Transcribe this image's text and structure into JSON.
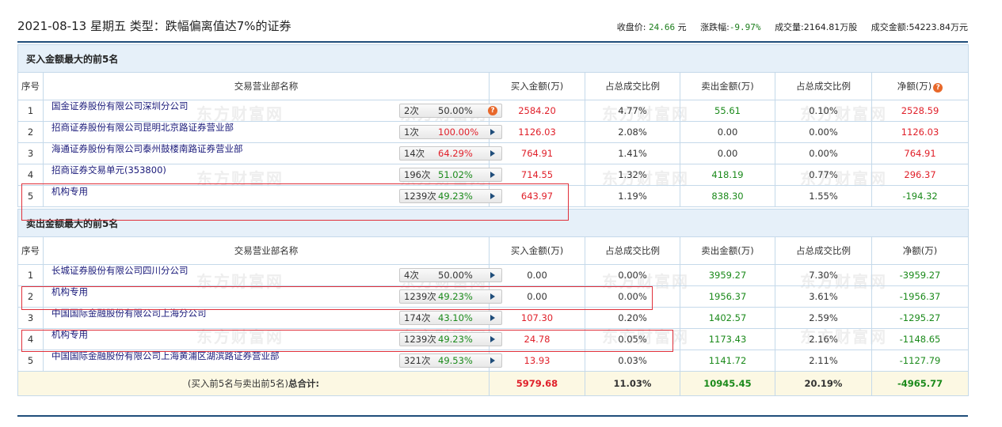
{
  "header": {
    "title": "2021-08-13 星期五 类型：跌幅偏离值达7%的证券",
    "close_label": "收盘价:",
    "close_value": "24.66",
    "close_unit": "元",
    "change_label": "涨跌幅:",
    "change_value": "-9.97%",
    "volume_label": "成交量:",
    "volume_value": "2164.81万股",
    "amount_label": "成交金额:",
    "amount_value": "54223.84万元"
  },
  "watermark": "东方财富网",
  "buy_section": {
    "title": "买入金额最大的前5名",
    "columns": [
      "序号",
      "交易营业部名称",
      "买入金额(万)",
      "占总成交比例",
      "卖出金额(万)",
      "占总成交比例",
      "净额(万)"
    ],
    "rows": [
      {
        "no": "1",
        "name": "国金证券股份有限公司深圳分公司",
        "count": "2次",
        "pct": "50.00%",
        "buy": "2584.20",
        "buy_ratio": "4.77%",
        "sell": "55.61",
        "sell_ratio": "0.10%",
        "net": "2528.59"
      },
      {
        "no": "2",
        "name": "招商证券股份有限公司昆明北京路证券营业部",
        "count": "1次",
        "pct": "100.00%",
        "buy": "1126.03",
        "buy_ratio": "2.08%",
        "sell": "0.00",
        "sell_ratio": "0.00%",
        "net": "1126.03"
      },
      {
        "no": "3",
        "name": "海通证券股份有限公司泰州鼓楼南路证券营业部",
        "count": "14次",
        "pct": "64.29%",
        "buy": "764.91",
        "buy_ratio": "1.41%",
        "sell": "0.00",
        "sell_ratio": "0.00%",
        "net": "764.91"
      },
      {
        "no": "4",
        "name": "招商证券交易单元(353800)",
        "count": "196次",
        "pct": "51.02%",
        "buy": "714.55",
        "buy_ratio": "1.32%",
        "sell": "418.19",
        "sell_ratio": "0.77%",
        "net": "296.37"
      },
      {
        "no": "5",
        "name": "机构专用",
        "count": "1239次",
        "pct": "49.23%",
        "buy": "643.97",
        "buy_ratio": "1.19%",
        "sell": "838.30",
        "sell_ratio": "1.55%",
        "net": "-194.32"
      }
    ]
  },
  "sell_section": {
    "title": "卖出金额最大的前5名",
    "columns": [
      "序号",
      "交易营业部名称",
      "买入金额(万)",
      "占总成交比例",
      "卖出金额(万)",
      "占总成交比例",
      "净额(万)"
    ],
    "rows": [
      {
        "no": "1",
        "name": "长城证券股份有限公司四川分公司",
        "count": "4次",
        "pct": "50.00%",
        "buy": "0.00",
        "buy_ratio": "0.00%",
        "sell": "3959.27",
        "sell_ratio": "7.30%",
        "net": "-3959.27"
      },
      {
        "no": "2",
        "name": "机构专用",
        "count": "1239次",
        "pct": "49.23%",
        "buy": "0.00",
        "buy_ratio": "0.00%",
        "sell": "1956.37",
        "sell_ratio": "3.61%",
        "net": "-1956.37"
      },
      {
        "no": "3",
        "name": "中国国际金融股份有限公司上海分公司",
        "count": "174次",
        "pct": "43.10%",
        "buy": "107.30",
        "buy_ratio": "0.20%",
        "sell": "1402.57",
        "sell_ratio": "2.59%",
        "net": "-1295.27"
      },
      {
        "no": "4",
        "name": "机构专用",
        "count": "1239次",
        "pct": "49.23%",
        "buy": "24.78",
        "buy_ratio": "0.05%",
        "sell": "1173.43",
        "sell_ratio": "2.16%",
        "net": "-1148.65"
      },
      {
        "no": "5",
        "name": "中国国际金融股份有限公司上海黄浦区湖滨路证券营业部",
        "count": "321次",
        "pct": "49.53%",
        "buy": "13.93",
        "buy_ratio": "0.03%",
        "sell": "1141.72",
        "sell_ratio": "2.11%",
        "net": "-1127.79"
      }
    ]
  },
  "total": {
    "label_prefix": "(买入前5名与卖出前5名)",
    "label_bold": "总合计:",
    "buy": "5979.68",
    "buy_ratio": "11.03%",
    "sell": "10945.45",
    "sell_ratio": "20.19%",
    "net": "-4965.77"
  },
  "colors": {
    "up": "#e0202a",
    "down": "#1b8a1b",
    "accent": "#1f4d7a",
    "highlight": "#e0303a"
  }
}
